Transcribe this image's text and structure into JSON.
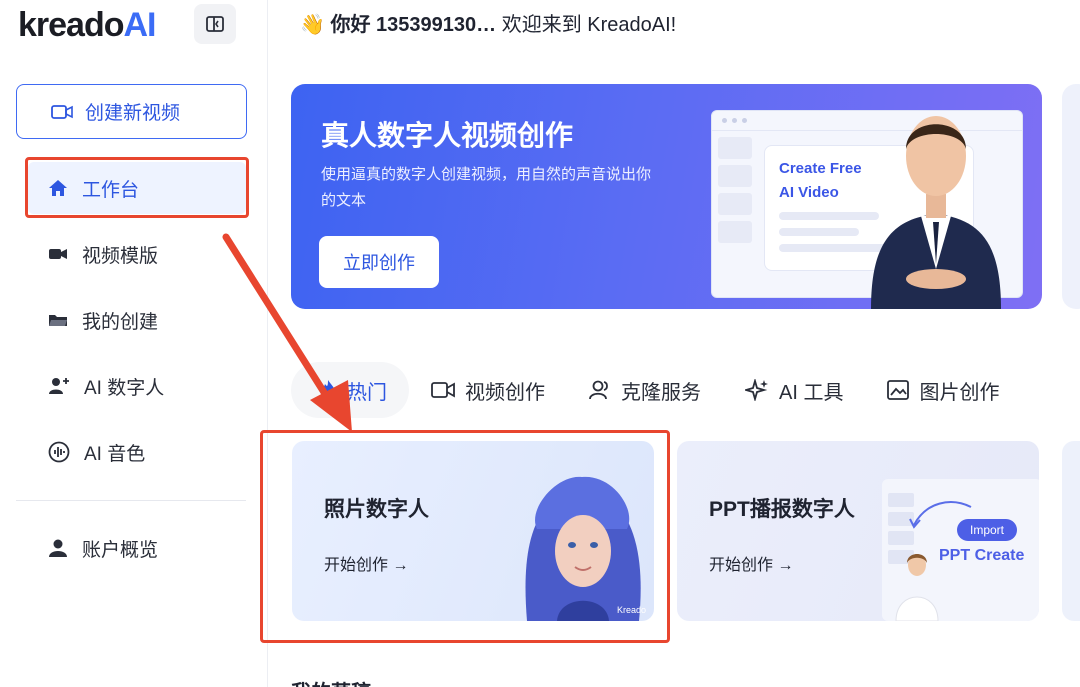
{
  "logo": {
    "text": "kreado",
    "ai": "AI"
  },
  "header": {
    "wave": "👋",
    "greeting_prefix": "你好",
    "username": "135399130…",
    "welcome": "欢迎来到 KreadoAI!"
  },
  "sidebar": {
    "new_video": "创建新视频",
    "items": [
      {
        "label": "工作台",
        "icon": "home-icon"
      },
      {
        "label": "视频模版",
        "icon": "video-camera-icon"
      },
      {
        "label": "我的创建",
        "icon": "folder-icon"
      },
      {
        "label": "AI 数字人",
        "icon": "user-plus-icon"
      },
      {
        "label": "AI 音色",
        "icon": "audio-wave-icon"
      }
    ],
    "account": "账户概览"
  },
  "banner": {
    "title": "真人数字人视频创作",
    "desc": "使用逼真的数字人创建视频，用自然的声音说出你的文本",
    "button": "立即创作",
    "mock_line1": "Create Free",
    "mock_line2": "AI Video"
  },
  "tabs": [
    {
      "label": "热门",
      "icon": "fire-icon"
    },
    {
      "label": "视频创作",
      "icon": "video-icon"
    },
    {
      "label": "克隆服务",
      "icon": "clone-icon"
    },
    {
      "label": "AI 工具",
      "icon": "sparkle-icon"
    },
    {
      "label": "图片创作",
      "icon": "image-icon"
    }
  ],
  "cards": [
    {
      "title": "照片数字人",
      "link": "开始创作 →",
      "watermark": "Kreado"
    },
    {
      "title": "PPT播报数字人",
      "link": "开始创作 →",
      "badge": "Import",
      "caption": "PPT Create"
    }
  ],
  "bottom_title": "我的草稿",
  "colors": {
    "accent": "#2d56e0",
    "highlight": "#e8462f"
  }
}
